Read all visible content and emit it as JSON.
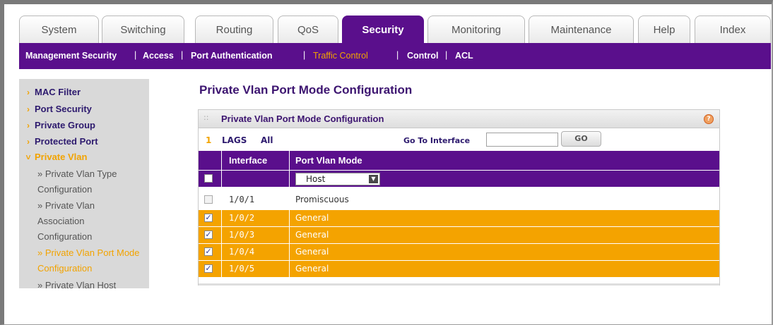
{
  "tabs": [
    {
      "label": "System"
    },
    {
      "label": "Switching"
    },
    {
      "label": "Routing"
    },
    {
      "label": "QoS"
    },
    {
      "label": "Security"
    },
    {
      "label": "Monitoring"
    },
    {
      "label": "Maintenance"
    },
    {
      "label": "Help"
    },
    {
      "label": "Index"
    }
  ],
  "subnav": [
    {
      "label": "Management Security"
    },
    {
      "label": "Access"
    },
    {
      "label": "Port Authentication"
    },
    {
      "label": "Traffic Control"
    },
    {
      "label": "Control"
    },
    {
      "label": "ACL"
    }
  ],
  "sidebar": {
    "items": [
      {
        "label": "MAC Filter"
      },
      {
        "label": "Port Security"
      },
      {
        "label": "Private Group"
      },
      {
        "label": "Protected Port"
      },
      {
        "label": "Private Vlan"
      }
    ],
    "subitems": [
      {
        "label": "» Private Vlan Type Configuration"
      },
      {
        "label": "» Private Vlan Association Configuration"
      },
      {
        "label": "» Private Vlan Port Mode Configuration"
      },
      {
        "label": "» Private Vlan Host"
      }
    ]
  },
  "page_title": "Private Vlan Port Mode Configuration",
  "panel": {
    "title": "Private Vlan Port Mode Configuration",
    "filter_num": "1",
    "filter_lags": "LAGS",
    "filter_all": "All",
    "goto_label": "Go To Interface",
    "goto_value": "",
    "go_button": "GO"
  },
  "table": {
    "headers": {
      "interface": "Interface",
      "mode": "Port Vlan Mode"
    },
    "select_value": "Host",
    "rows": [
      {
        "checked": "",
        "interface": "1/0/1",
        "mode": "Promiscuous"
      },
      {
        "checked": "✓",
        "interface": "1/0/2",
        "mode": "General"
      },
      {
        "checked": "✓",
        "interface": "1/0/3",
        "mode": "General"
      },
      {
        "checked": "✓",
        "interface": "1/0/4",
        "mode": "General"
      },
      {
        "checked": "✓",
        "interface": "1/0/5",
        "mode": "General"
      }
    ]
  },
  "colors": {
    "brand": "#5a0f8c",
    "accent": "#f4a300"
  }
}
